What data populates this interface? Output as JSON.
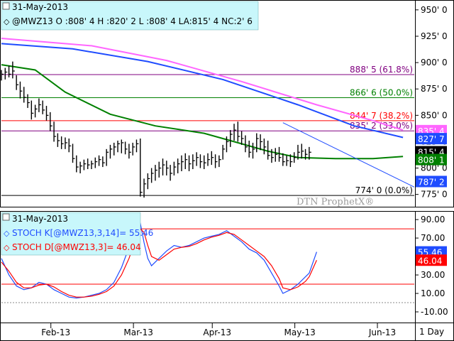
{
  "chart_data": [
    {
      "type": "candlestick",
      "date": "31-May-2013",
      "title": "@MWZ13 O :808' 4 H :820' 2 L :808' 4 LA:815' 4 NC:2' 6",
      "yticks": [
        "950' 0",
        "925' 0",
        "900' 0",
        "875' 0",
        "850' 0",
        "825' 0",
        "800' 0",
        "775' 0"
      ],
      "yticks_values": [
        950,
        925,
        900,
        875,
        850,
        825,
        800,
        775
      ],
      "ylim": [
        764,
        958
      ],
      "xlabels": [
        "Feb-13",
        "Mar-13",
        "Apr-13",
        "May-13",
        "Jun-13"
      ],
      "xlabel_positions": [
        15.5,
        37.5,
        58.5,
        80.5,
        102.5
      ],
      "xlim": [
        1,
        111
      ],
      "levels": [
        {
          "label": "888' 5 (61.8%)",
          "value": 888.6,
          "color": "#800080"
        },
        {
          "label": "866' 6 (50.0%)",
          "value": 866.75,
          "color": "#008000"
        },
        {
          "label": "844' 7 (38.2%)",
          "value": 844.9,
          "color": "#ff0000"
        },
        {
          "label": "835' 2 (33.0%)",
          "value": 835.25,
          "color": "#800080"
        },
        {
          "label": "774' 0 (0.0%)",
          "value": 774.0,
          "color": "#000000"
        }
      ],
      "price_tags": [
        {
          "label": "835' 4",
          "value": 835.5,
          "color": "#ff66ff"
        },
        {
          "label": "827' 7",
          "value": 827.9,
          "color": "#1f4cff"
        },
        {
          "label": "815' 4",
          "value": 815.5,
          "color": "#000000"
        },
        {
          "label": "808' 1",
          "value": 808.1,
          "color": "#008000"
        },
        {
          "label": "787' 2",
          "value": 787.25,
          "color": "#1f4cff"
        }
      ],
      "moving_averages": [
        {
          "color": "#ff66ff",
          "points": [
            [
              1,
              923
            ],
            [
              25,
              916
            ],
            [
              45,
              902
            ],
            [
              65,
              882
            ],
            [
              85,
              860
            ],
            [
              100,
              845
            ],
            [
              108,
              836
            ]
          ]
        },
        {
          "color": "#1f4cff",
          "points": [
            [
              1,
              918
            ],
            [
              20,
              913
            ],
            [
              40,
              901
            ],
            [
              60,
              884
            ],
            [
              80,
              860
            ],
            [
              95,
              840
            ],
            [
              108,
              829
            ]
          ]
        },
        {
          "color": "#008000",
          "points": [
            [
              1,
              898
            ],
            [
              10,
              893
            ],
            [
              18,
              872
            ],
            [
              30,
              851
            ],
            [
              42,
              840
            ],
            [
              55,
              833
            ],
            [
              65,
              823
            ],
            [
              72,
              816
            ],
            [
              80,
              810
            ],
            [
              90,
              809
            ],
            [
              100,
              809
            ],
            [
              108,
              811
            ]
          ]
        }
      ],
      "trendline": {
        "color": "#1f4cff",
        "points": [
          [
            76,
            843
          ],
          [
            111,
            782
          ]
        ]
      },
      "bars": [
        {
          "x": 1,
          "h": 893,
          "l": 883,
          "c": 889
        },
        {
          "x": 2,
          "h": 895,
          "l": 884,
          "c": 891
        },
        {
          "x": 3,
          "h": 897,
          "l": 886,
          "c": 889
        },
        {
          "x": 4,
          "h": 901,
          "l": 885,
          "c": 892
        },
        {
          "x": 5,
          "h": 888,
          "l": 874,
          "c": 879
        },
        {
          "x": 6,
          "h": 882,
          "l": 866,
          "c": 873
        },
        {
          "x": 7,
          "h": 877,
          "l": 862,
          "c": 867
        },
        {
          "x": 8,
          "h": 870,
          "l": 857,
          "c": 862
        },
        {
          "x": 9,
          "h": 864,
          "l": 846,
          "c": 852
        },
        {
          "x": 10,
          "h": 860,
          "l": 848,
          "c": 856
        },
        {
          "x": 11,
          "h": 866,
          "l": 853,
          "c": 860
        },
        {
          "x": 12,
          "h": 864,
          "l": 851,
          "c": 855
        },
        {
          "x": 13,
          "h": 859,
          "l": 845,
          "c": 850
        },
        {
          "x": 14,
          "h": 853,
          "l": 835,
          "c": 840
        },
        {
          "x": 15,
          "h": 844,
          "l": 825,
          "c": 830
        },
        {
          "x": 16,
          "h": 833,
          "l": 820,
          "c": 826
        },
        {
          "x": 17,
          "h": 830,
          "l": 818,
          "c": 823
        },
        {
          "x": 18,
          "h": 829,
          "l": 818,
          "c": 824
        },
        {
          "x": 19,
          "h": 828,
          "l": 815,
          "c": 821
        },
        {
          "x": 20,
          "h": 823,
          "l": 805,
          "c": 809
        },
        {
          "x": 21,
          "h": 812,
          "l": 796,
          "c": 801
        },
        {
          "x": 22,
          "h": 806,
          "l": 795,
          "c": 802
        },
        {
          "x": 23,
          "h": 808,
          "l": 798,
          "c": 804
        },
        {
          "x": 24,
          "h": 809,
          "l": 799,
          "c": 803
        },
        {
          "x": 25,
          "h": 807,
          "l": 799,
          "c": 804
        },
        {
          "x": 26,
          "h": 810,
          "l": 800,
          "c": 806
        },
        {
          "x": 27,
          "h": 812,
          "l": 802,
          "c": 808
        },
        {
          "x": 28,
          "h": 811,
          "l": 801,
          "c": 805
        },
        {
          "x": 29,
          "h": 818,
          "l": 802,
          "c": 815
        },
        {
          "x": 30,
          "h": 822,
          "l": 809,
          "c": 818
        },
        {
          "x": 31,
          "h": 824,
          "l": 812,
          "c": 820
        },
        {
          "x": 32,
          "h": 826,
          "l": 815,
          "c": 823
        },
        {
          "x": 33,
          "h": 827,
          "l": 814,
          "c": 824
        },
        {
          "x": 34,
          "h": 825,
          "l": 813,
          "c": 818
        },
        {
          "x": 35,
          "h": 823,
          "l": 809,
          "c": 815
        },
        {
          "x": 36,
          "h": 824,
          "l": 812,
          "c": 820
        },
        {
          "x": 37,
          "h": 827,
          "l": 815,
          "c": 823
        },
        {
          "x": 38,
          "h": 828,
          "l": 773,
          "c": 777
        },
        {
          "x": 39,
          "h": 790,
          "l": 772,
          "c": 785
        },
        {
          "x": 40,
          "h": 795,
          "l": 780,
          "c": 790
        },
        {
          "x": 41,
          "h": 800,
          "l": 786,
          "c": 795
        },
        {
          "x": 42,
          "h": 803,
          "l": 788,
          "c": 798
        },
        {
          "x": 43,
          "h": 806,
          "l": 791,
          "c": 800
        },
        {
          "x": 44,
          "h": 809,
          "l": 793,
          "c": 803
        },
        {
          "x": 45,
          "h": 807,
          "l": 793,
          "c": 800
        },
        {
          "x": 46,
          "h": 803,
          "l": 788,
          "c": 795
        },
        {
          "x": 47,
          "h": 806,
          "l": 793,
          "c": 801
        },
        {
          "x": 48,
          "h": 809,
          "l": 795,
          "c": 804
        },
        {
          "x": 49,
          "h": 812,
          "l": 797,
          "c": 806
        },
        {
          "x": 50,
          "h": 814,
          "l": 799,
          "c": 808
        },
        {
          "x": 51,
          "h": 812,
          "l": 797,
          "c": 804
        },
        {
          "x": 52,
          "h": 813,
          "l": 799,
          "c": 807
        },
        {
          "x": 53,
          "h": 815,
          "l": 802,
          "c": 810
        },
        {
          "x": 54,
          "h": 813,
          "l": 800,
          "c": 806
        },
        {
          "x": 55,
          "h": 812,
          "l": 799,
          "c": 805
        },
        {
          "x": 56,
          "h": 814,
          "l": 802,
          "c": 808
        },
        {
          "x": 57,
          "h": 816,
          "l": 803,
          "c": 810
        },
        {
          "x": 58,
          "h": 813,
          "l": 800,
          "c": 806
        },
        {
          "x": 59,
          "h": 812,
          "l": 801,
          "c": 808
        },
        {
          "x": 60,
          "h": 822,
          "l": 808,
          "c": 818
        },
        {
          "x": 61,
          "h": 830,
          "l": 815,
          "c": 825
        },
        {
          "x": 62,
          "h": 836,
          "l": 820,
          "c": 832
        },
        {
          "x": 63,
          "h": 842,
          "l": 826,
          "c": 836
        },
        {
          "x": 64,
          "h": 844,
          "l": 825,
          "c": 830
        },
        {
          "x": 65,
          "h": 835,
          "l": 822,
          "c": 828
        },
        {
          "x": 66,
          "h": 831,
          "l": 815,
          "c": 820
        },
        {
          "x": 67,
          "h": 826,
          "l": 810,
          "c": 815
        },
        {
          "x": 68,
          "h": 824,
          "l": 809,
          "c": 818
        },
        {
          "x": 69,
          "h": 833,
          "l": 815,
          "c": 828
        },
        {
          "x": 70,
          "h": 832,
          "l": 817,
          "c": 825
        },
        {
          "x": 71,
          "h": 828,
          "l": 813,
          "c": 820
        },
        {
          "x": 72,
          "h": 826,
          "l": 808,
          "c": 812
        },
        {
          "x": 73,
          "h": 818,
          "l": 805,
          "c": 810
        },
        {
          "x": 74,
          "h": 819,
          "l": 806,
          "c": 813
        },
        {
          "x": 75,
          "h": 820,
          "l": 806,
          "c": 810
        },
        {
          "x": 76,
          "h": 814,
          "l": 802,
          "c": 806
        },
        {
          "x": 77,
          "h": 812,
          "l": 802,
          "c": 807
        },
        {
          "x": 78,
          "h": 813,
          "l": 801,
          "c": 806
        },
        {
          "x": 79,
          "h": 815,
          "l": 805,
          "c": 810
        },
        {
          "x": 80,
          "h": 822,
          "l": 808,
          "c": 815
        },
        {
          "x": 81,
          "h": 823,
          "l": 809,
          "c": 816
        },
        {
          "x": 82,
          "h": 818,
          "l": 808,
          "c": 813
        },
        {
          "x": 83,
          "h": 820,
          "l": 808,
          "c": 815
        }
      ]
    },
    {
      "type": "line",
      "date": "31-May-2013",
      "yticks": [
        "90.00",
        "70.00",
        "50.00",
        "30.00",
        "10.00",
        "-10.00"
      ],
      "yticks_values": [
        90,
        70,
        50,
        30,
        10,
        -10
      ],
      "ylim": [
        -20,
        97
      ],
      "xlim": [
        1,
        111
      ],
      "hlines": [
        {
          "value": 80,
          "color": "#ff0000",
          "style": "solid"
        },
        {
          "value": 20,
          "color": "#ff0000",
          "style": "solid"
        },
        {
          "value": 0,
          "color": "#888888",
          "style": "dotted"
        }
      ],
      "series": [
        {
          "name": "STOCH K[@MWZ13,3,14]= 55.46",
          "color": "#1f4cff",
          "value_label": "55.46",
          "points": [
            [
              1,
              48
            ],
            [
              3,
              30
            ],
            [
              5,
              18
            ],
            [
              7,
              14
            ],
            [
              9,
              16
            ],
            [
              11,
              22
            ],
            [
              13,
              20
            ],
            [
              15,
              14
            ],
            [
              17,
              10
            ],
            [
              19,
              6
            ],
            [
              21,
              5
            ],
            [
              23,
              6
            ],
            [
              25,
              8
            ],
            [
              27,
              10
            ],
            [
              29,
              14
            ],
            [
              31,
              22
            ],
            [
              33,
              38
            ],
            [
              35,
              60
            ],
            [
              37,
              84
            ],
            [
              38,
              86
            ],
            [
              39,
              65
            ],
            [
              40,
              48
            ],
            [
              41,
              40
            ],
            [
              43,
              48
            ],
            [
              45,
              56
            ],
            [
              47,
              62
            ],
            [
              49,
              60
            ],
            [
              51,
              62
            ],
            [
              53,
              66
            ],
            [
              55,
              70
            ],
            [
              57,
              72
            ],
            [
              59,
              74
            ],
            [
              61,
              78
            ],
            [
              63,
              72
            ],
            [
              65,
              66
            ],
            [
              67,
              58
            ],
            [
              69,
              54
            ],
            [
              71,
              46
            ],
            [
              73,
              32
            ],
            [
              75,
              18
            ],
            [
              76,
              10
            ],
            [
              78,
              14
            ],
            [
              80,
              20
            ],
            [
              82,
              28
            ],
            [
              83,
              32
            ],
            [
              85,
              55
            ]
          ]
        },
        {
          "name": "STOCH D[@MWZ13,3]= 46.04",
          "color": "#ff0000",
          "value_label": "46.04",
          "points": [
            [
              1,
              44
            ],
            [
              3,
              34
            ],
            [
              5,
              22
            ],
            [
              7,
              16
            ],
            [
              9,
              16
            ],
            [
              11,
              19
            ],
            [
              13,
              20
            ],
            [
              15,
              17
            ],
            [
              17,
              12
            ],
            [
              19,
              8
            ],
            [
              21,
              6
            ],
            [
              23,
              6
            ],
            [
              25,
              7
            ],
            [
              27,
              9
            ],
            [
              29,
              12
            ],
            [
              31,
              18
            ],
            [
              33,
              30
            ],
            [
              35,
              48
            ],
            [
              37,
              72
            ],
            [
              38,
              80
            ],
            [
              39,
              76
            ],
            [
              40,
              62
            ],
            [
              41,
              50
            ],
            [
              43,
              46
            ],
            [
              45,
              52
            ],
            [
              47,
              58
            ],
            [
              49,
              60
            ],
            [
              51,
              61
            ],
            [
              53,
              64
            ],
            [
              55,
              68
            ],
            [
              57,
              71
            ],
            [
              59,
              73
            ],
            [
              61,
              76
            ],
            [
              63,
              74
            ],
            [
              65,
              68
            ],
            [
              67,
              62
            ],
            [
              69,
              56
            ],
            [
              71,
              50
            ],
            [
              73,
              40
            ],
            [
              75,
              26
            ],
            [
              76,
              16
            ],
            [
              78,
              14
            ],
            [
              80,
              17
            ],
            [
              82,
              23
            ],
            [
              83,
              28
            ],
            [
              85,
              46
            ]
          ]
        }
      ]
    }
  ],
  "timeframe_label": "1 Day",
  "watermark": "DTN ProphetX®"
}
